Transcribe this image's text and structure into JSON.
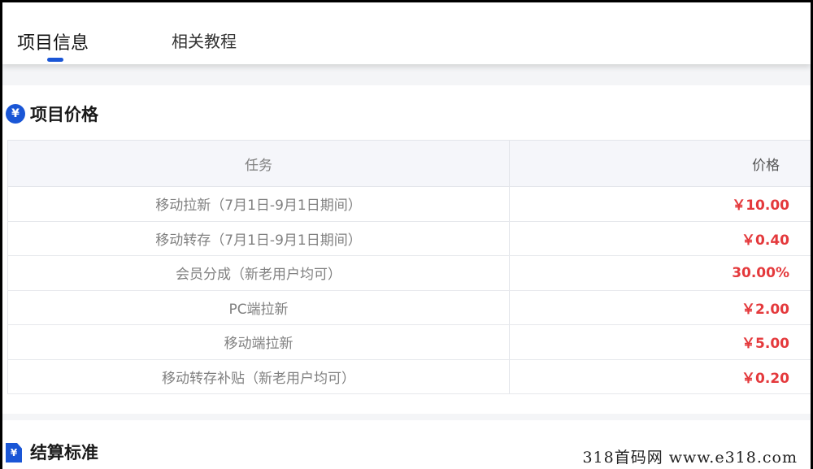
{
  "tabs": [
    {
      "label": "项目信息",
      "active": true
    },
    {
      "label": "相关教程",
      "active": false
    }
  ],
  "price_section": {
    "title": "项目价格",
    "icon": "yen-badge-icon",
    "accent_color": "#1a56d6",
    "price_color": "#e4393c",
    "columns": [
      "任务",
      "价格"
    ],
    "rows": [
      {
        "task": "移动拉新（7月1日-9月1日期间）",
        "price": "￥10.00"
      },
      {
        "task": "移动转存（7月1日-9月1日期间）",
        "price": "￥0.40"
      },
      {
        "task": "会员分成（新老用户均可）",
        "price": "30.00%"
      },
      {
        "task": "PC端拉新",
        "price": "￥2.00"
      },
      {
        "task": "移动端拉新",
        "price": "￥5.00"
      },
      {
        "task": "移动转存补贴（新老用户均可）",
        "price": "￥0.20"
      }
    ]
  },
  "settlement_section": {
    "title": "结算标准",
    "icon": "document-yen-icon"
  },
  "watermark": "318首码网  www.e318.com"
}
